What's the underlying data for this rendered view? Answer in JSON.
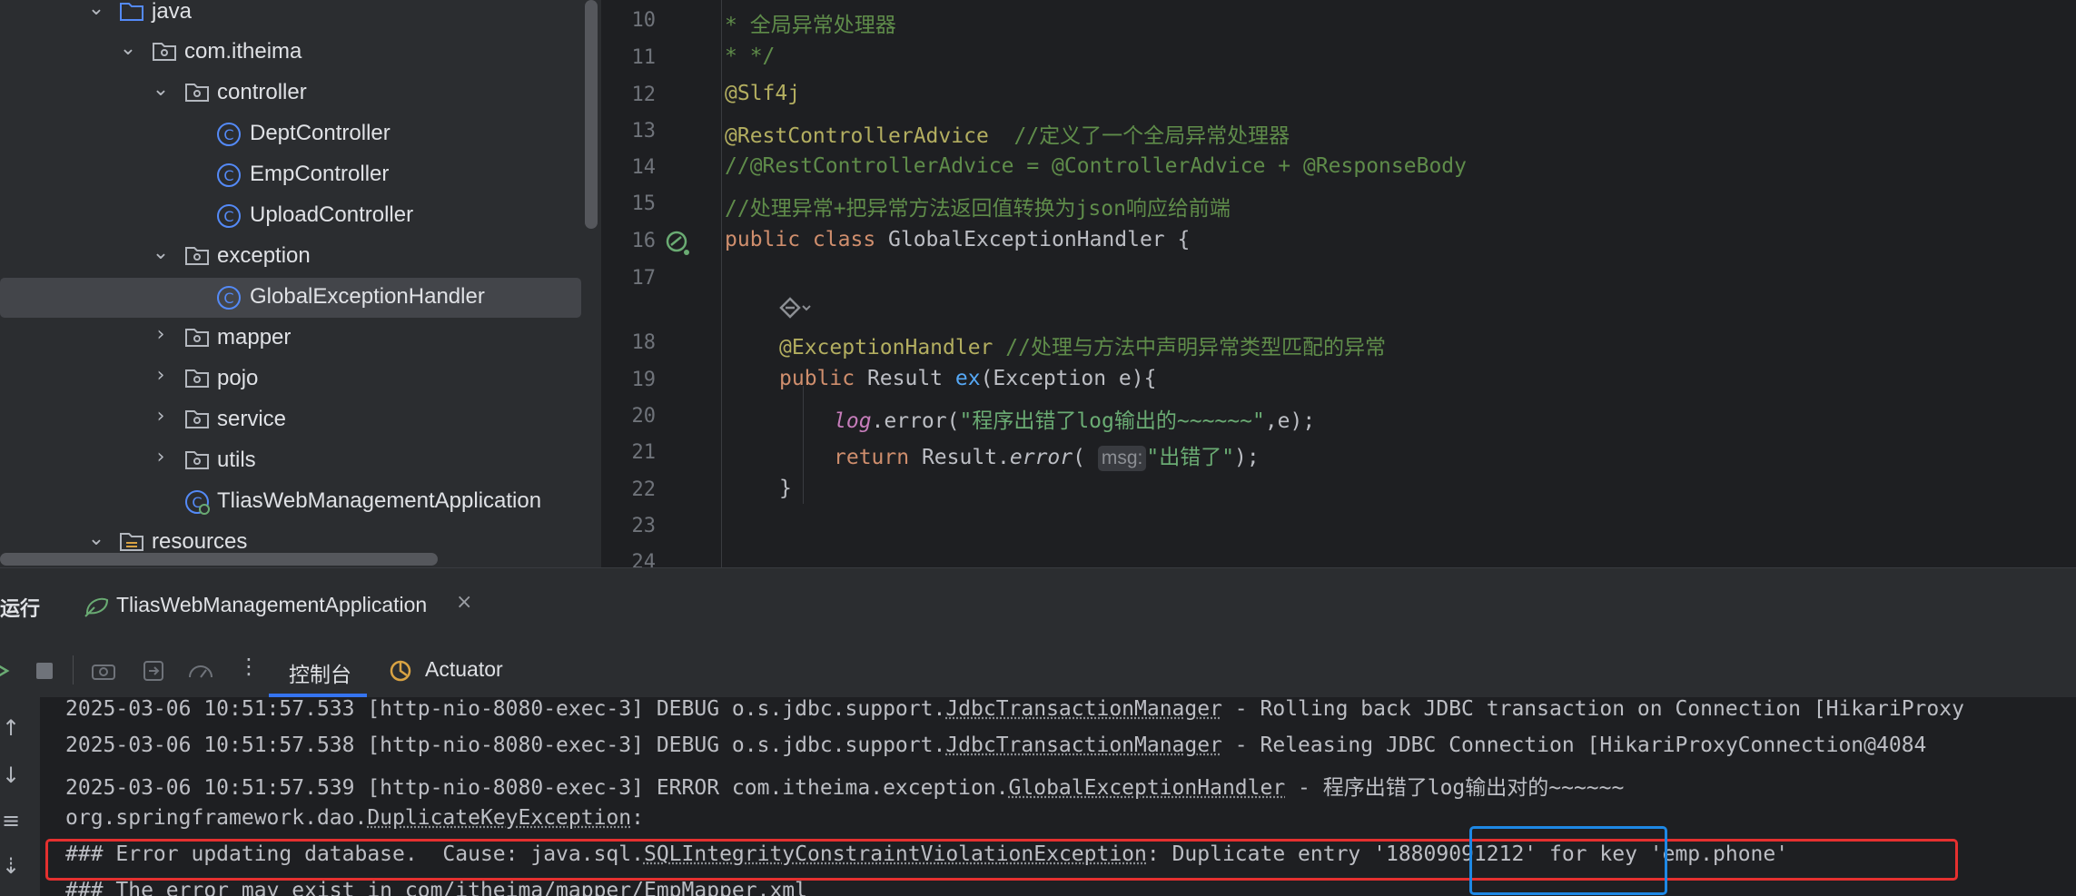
{
  "tree": {
    "items": [
      {
        "label": "java",
        "kind": "folder-src",
        "expanded": true
      },
      {
        "label": "com.itheima",
        "kind": "package",
        "expanded": true
      },
      {
        "label": "controller",
        "kind": "package",
        "expanded": true
      },
      {
        "label": "DeptController",
        "kind": "class"
      },
      {
        "label": "EmpController",
        "kind": "class"
      },
      {
        "label": "UploadController",
        "kind": "class"
      },
      {
        "label": "exception",
        "kind": "package",
        "expanded": true
      },
      {
        "label": "GlobalExceptionHandler",
        "kind": "class",
        "selected": true
      },
      {
        "label": "mapper",
        "kind": "package",
        "expanded": false
      },
      {
        "label": "pojo",
        "kind": "package",
        "expanded": false
      },
      {
        "label": "service",
        "kind": "package",
        "expanded": false
      },
      {
        "label": "utils",
        "kind": "package",
        "expanded": false
      },
      {
        "label": "TliasWebManagementApplication",
        "kind": "spring-class"
      },
      {
        "label": "resources",
        "kind": "folder-res",
        "expanded": true
      }
    ]
  },
  "editor": {
    "line_numbers": [
      "10",
      "11",
      "12",
      "13",
      "14",
      "15",
      "16",
      "17",
      "18",
      "19",
      "20",
      "21",
      "22",
      "23",
      "24"
    ],
    "l10": "* 全局异常处理器",
    "l11": "* */",
    "l12": "@Slf4j",
    "l13_an": "@RestControllerAdvice",
    "l13_cm": "  //定义了一个全局异常处理器",
    "l14": "//@RestControllerAdvice = @ControllerAdvice + @ResponseBody",
    "l15": "//处理异常+把异常方法返回值转换为json响应给前端",
    "l16_kw": "public class ",
    "l16_rest": "GlobalExceptionHandler {",
    "l18_an": "@ExceptionHandler",
    "l18_cm": " //处理与方法中声明异常类型匹配的异常",
    "l19_kw": "public ",
    "l19_type": "Result ",
    "l19_fn": "ex",
    "l19_rest": "(Exception e){",
    "l20_var": "log",
    "l20_mid": ".error(",
    "l20_str": "\"程序出错了log输出的~~~~~~\"",
    "l20_end": ",e);",
    "l21_kw": "return ",
    "l21_cls": "Result.",
    "l21_fn": "error",
    "l21_open": "( ",
    "l21_hint": "msg:",
    "l21_str": "\"出错了\"",
    "l21_end": ");",
    "l22": "}"
  },
  "run": {
    "title": "运行",
    "tab_label": "TliasWebManagementApplication",
    "close_glyph": "×",
    "tabs": {
      "console": "控制台",
      "actuator": "Actuator"
    }
  },
  "console": {
    "line1_a": "2025-03-06 10:51:57.533 [http-nio-8080-exec-3] DEBUG o.s.jdbc.support.",
    "line1_b": "JdbcTransactionManager",
    "line1_c": " - Rolling back JDBC transaction on Connection [HikariProxy",
    "line2_a": "2025-03-06 10:51:57.538 [http-nio-8080-exec-3] DEBUG o.s.jdbc.support.",
    "line2_b": "JdbcTransactionManager",
    "line2_c": " - Releasing JDBC Connection [HikariProxyConnection@4084",
    "line3_a": "2025-03-06 10:51:57.539 [http-nio-8080-exec-3] ERROR com.itheima.exception.",
    "line3_b": "GlobalExceptionHandler",
    "line3_c": " - 程序出错了log输出对的~~~~~~",
    "line4_a": "org.springframework.dao.",
    "line4_b": "DuplicateKeyException",
    "line4_c": ":",
    "line5_a": "### Error updating database.  Cause: java.sql.",
    "line5_b": "SQLIntegrityConstraintViolationException",
    "line5_c": ": Duplicate entry '18809091212' for key 'emp.phone'",
    "line6": "### The error may exist in com/itheima/mapper/EmpMapper.xml"
  }
}
